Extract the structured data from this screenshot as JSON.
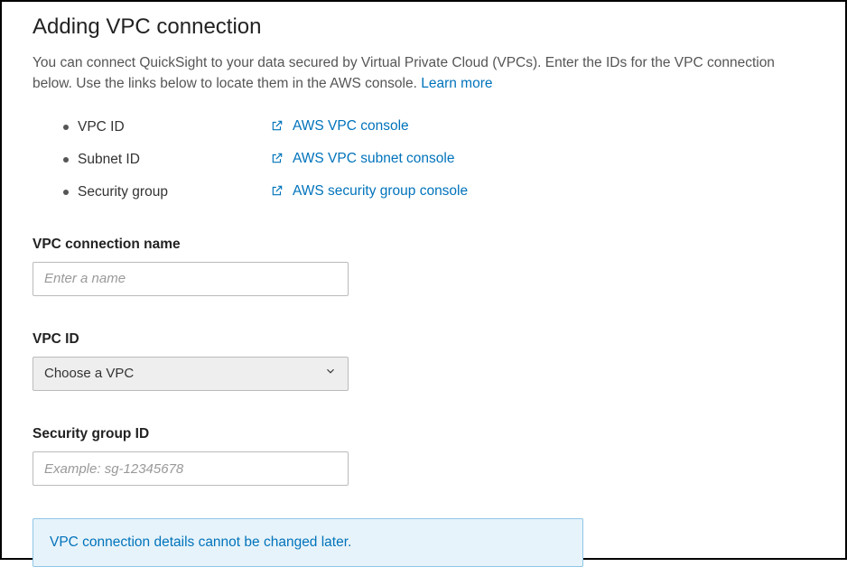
{
  "header": {
    "title": "Adding VPC connection",
    "intro_a": "You can connect QuickSight to your data secured by Virtual Private Cloud (VPCs). Enter the IDs for the VPC connection below. Use the links below to locate them in the AWS console. ",
    "learn_more": "Learn more"
  },
  "id_rows": [
    {
      "label": "VPC ID",
      "link": "AWS VPC console"
    },
    {
      "label": "Subnet ID",
      "link": "AWS VPC subnet console"
    },
    {
      "label": "Security group",
      "link": "AWS security group console"
    }
  ],
  "form": {
    "name_label": "VPC connection name",
    "name_placeholder": "Enter a name",
    "name_value": "",
    "vpc_label": "VPC ID",
    "vpc_selected": "Choose a VPC",
    "sg_label": "Security group ID",
    "sg_placeholder": "Example: sg-12345678",
    "sg_value": ""
  },
  "info": {
    "text": "VPC connection details cannot be changed later."
  }
}
